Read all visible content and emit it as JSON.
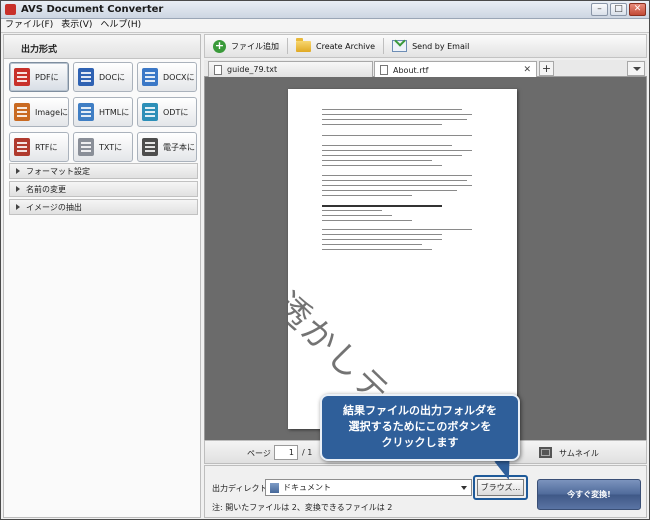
{
  "window": {
    "title": "AVS Document Converter"
  },
  "menu": [
    "ファイル(F)",
    "表示(V)",
    "ヘルプ(H)"
  ],
  "left_panel": {
    "header": "出力形式",
    "formats": [
      {
        "label": "PDFに",
        "color": "#c8302a",
        "active": true
      },
      {
        "label": "DOCに",
        "color": "#2f62b3",
        "active": false
      },
      {
        "label": "DOCXに",
        "color": "#3b78c7",
        "active": false
      },
      {
        "label": "Imageに",
        "color": "#c96a22",
        "active": false
      },
      {
        "label": "HTMLに",
        "color": "#3f7ec4",
        "active": false
      },
      {
        "label": "ODTに",
        "color": "#2c8fb8",
        "active": false
      },
      {
        "label": "RTFに",
        "color": "#b03a2e",
        "active": false
      },
      {
        "label": "TXTに",
        "color": "#8a8f98",
        "active": false
      },
      {
        "label": "電子本に",
        "color": "#4d4d4d",
        "active": false
      }
    ],
    "sections": [
      "フォーマット設定",
      "名前の変更",
      "イメージの抽出"
    ]
  },
  "toolbar": {
    "add_files": "ファイル追加",
    "create_archive": "Create Archive",
    "send_by_email": "Send by Email"
  },
  "tabs": [
    {
      "label": "guide_79.txt",
      "active": false
    },
    {
      "label": "About.rtf",
      "active": true
    }
  ],
  "preview": {
    "watermark": "透かしテキスト"
  },
  "pagebar": {
    "page_label": "ページ",
    "current_page": "1",
    "total": "/ 1",
    "thumbnails_label": "サムネイル"
  },
  "bottom": {
    "output_dir_label": "出力ディレクトリ:",
    "output_dir_value": "ドキュメント",
    "browse": "ブラウズ...",
    "convert": "今すぐ変換!",
    "note": "注: 開いたファイルは 2、変換できるファイルは 2"
  },
  "callout": {
    "lines": [
      "結果ファイルの出力フォルダを",
      "選択するためにこのボタンを",
      "クリックします"
    ]
  }
}
